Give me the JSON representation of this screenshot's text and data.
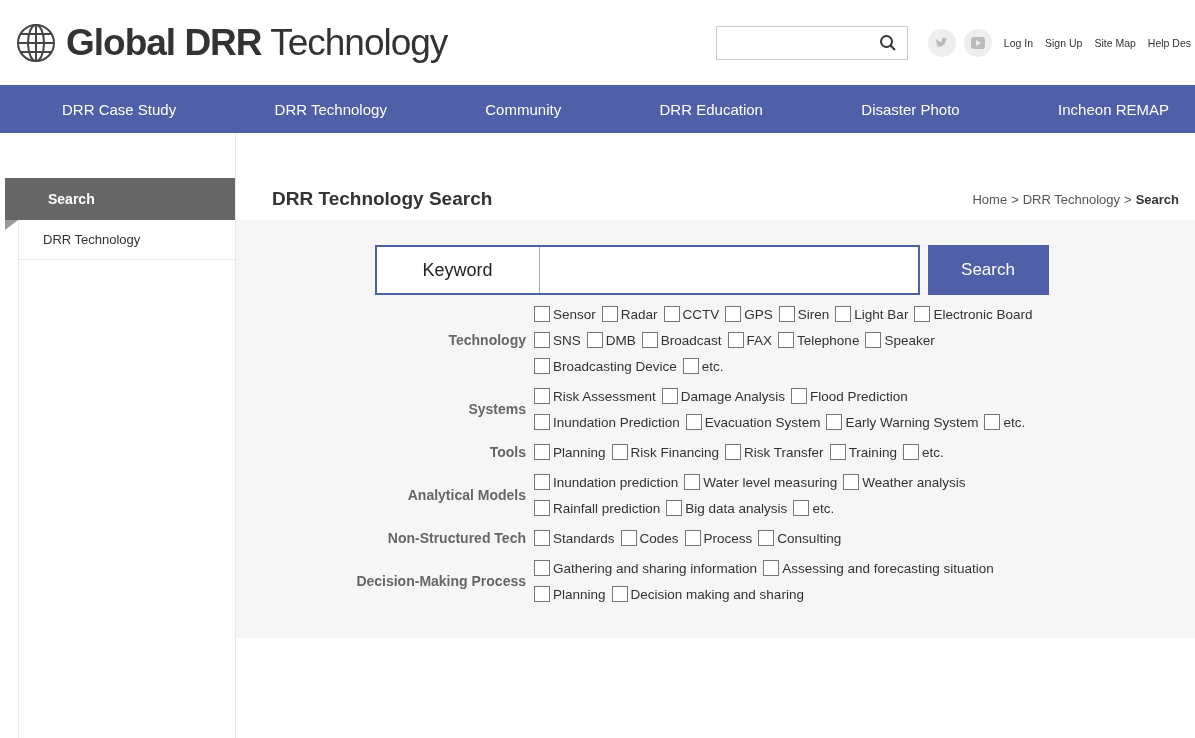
{
  "header": {
    "logo_bold": "Global DRR",
    "logo_light": "Technology",
    "links": [
      "Log In",
      "Sign Up",
      "Site Map",
      "Help Des"
    ]
  },
  "nav": [
    "DRR Case Study",
    "DRR Technology",
    "Community",
    "DRR Education",
    "Disaster Photo",
    "Incheon REMAP"
  ],
  "sidebar": {
    "title": "Search",
    "items": [
      {
        "label": "DRR Technology",
        "selected": false
      }
    ]
  },
  "page": {
    "title": "DRR Technology Search",
    "breadcrumb": [
      "Home",
      ">",
      "DRR Technology",
      ">",
      "Search"
    ]
  },
  "search_form": {
    "keyword_label": "Keyword",
    "button": "Search",
    "groups": [
      {
        "label": "Technology",
        "lines": [
          [
            {
              "label": "Sensor",
              "checked": false
            },
            {
              "label": "Radar",
              "checked": false
            },
            {
              "label": "CCTV",
              "checked": false
            },
            {
              "label": "GPS",
              "checked": false
            },
            {
              "label": "Siren",
              "checked": false
            },
            {
              "label": "Light Bar",
              "checked": false
            },
            {
              "label": "Electronic Board",
              "checked": false
            }
          ],
          [
            {
              "label": "SNS",
              "checked": false
            },
            {
              "label": "DMB",
              "checked": false
            },
            {
              "label": "Broadcast",
              "checked": false
            },
            {
              "label": "FAX",
              "checked": false
            },
            {
              "label": "Telephone",
              "checked": false
            },
            {
              "label": "Speaker",
              "checked": false
            }
          ],
          [
            {
              "label": "Broadcasting Device",
              "checked": false
            },
            {
              "label": "etc.",
              "checked": false
            }
          ]
        ]
      },
      {
        "label": "Systems",
        "lines": [
          [
            {
              "label": "Risk Assessment",
              "checked": false
            },
            {
              "label": "Damage Analysis",
              "checked": false
            },
            {
              "label": "Flood Prediction",
              "checked": false
            }
          ],
          [
            {
              "label": "Inundation Prediction",
              "checked": false
            },
            {
              "label": "Evacuation System",
              "checked": false
            },
            {
              "label": "Early Warning System",
              "checked": false
            },
            {
              "label": "etc.",
              "checked": false
            }
          ]
        ]
      },
      {
        "label": "Tools",
        "lines": [
          [
            {
              "label": "Planning",
              "checked": false
            },
            {
              "label": "Risk Financing",
              "checked": false
            },
            {
              "label": "Risk Transfer",
              "checked": false
            },
            {
              "label": "Training",
              "checked": false
            },
            {
              "label": "etc.",
              "checked": false
            }
          ]
        ]
      },
      {
        "label": "Analytical Models",
        "lines": [
          [
            {
              "label": "Inundation prediction",
              "checked": false
            },
            {
              "label": "Water level measuring",
              "checked": false
            },
            {
              "label": "Weather analysis",
              "checked": false
            }
          ],
          [
            {
              "label": "Rainfall prediction",
              "checked": false
            },
            {
              "label": "Big data analysis",
              "checked": false
            },
            {
              "label": "etc.",
              "checked": false
            }
          ]
        ]
      },
      {
        "label": "Non-Structured Tech",
        "lines": [
          [
            {
              "label": "Standards",
              "checked": false
            },
            {
              "label": "Codes",
              "checked": false
            },
            {
              "label": "Process",
              "checked": false
            },
            {
              "label": "Consulting",
              "checked": false
            }
          ]
        ]
      },
      {
        "label": "Decision-Making Process",
        "lines": [
          [
            {
              "label": "Gathering and sharing information",
              "checked": false
            },
            {
              "label": "Assessing and forecasting situation",
              "checked": false
            }
          ],
          [
            {
              "label": "Planning",
              "checked": false
            },
            {
              "label": "Decision making and sharing",
              "checked": false
            }
          ]
        ]
      }
    ]
  }
}
